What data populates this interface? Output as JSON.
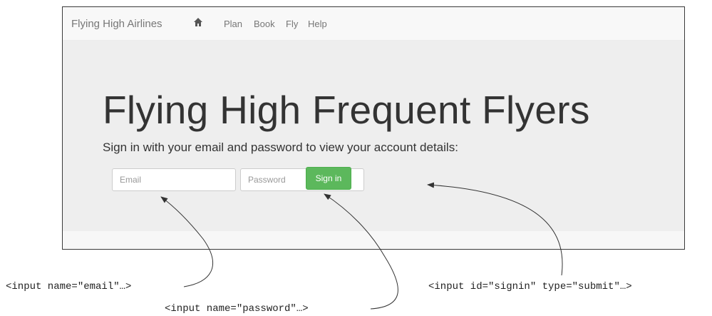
{
  "navbar": {
    "brand": "Flying High Airlines",
    "home_icon": "home-icon",
    "items": [
      {
        "label": "Plan"
      },
      {
        "label": "Book"
      },
      {
        "label": "Fly"
      },
      {
        "label": "Help"
      }
    ]
  },
  "jumbotron": {
    "title": "Flying High Frequent Flyers",
    "lead": "Sign in with your email and password to view your account details:"
  },
  "form": {
    "email_placeholder": "Email",
    "password_placeholder": "Password",
    "signin_label": "Sign in"
  },
  "annotations": {
    "email": "<input name=\"email\"…>",
    "password": "<input name=\"password\"…>",
    "signin": "<input id=\"signin\" type=\"submit\"…>"
  },
  "colors": {
    "signin_bg": "#5cb85c",
    "jumbotron_bg": "#eeeeee",
    "navbar_bg": "#f8f8f8"
  }
}
